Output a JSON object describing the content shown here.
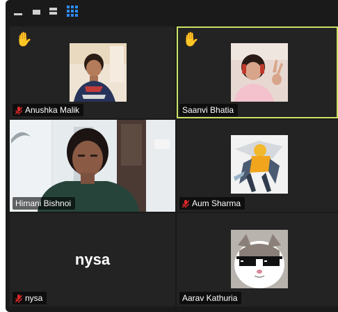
{
  "toolbar": {
    "minimize_icon": "minimize-icon",
    "stop_video_icon": "stop-video-icon",
    "speaker_view_icon": "speaker-view-icon",
    "gallery_view_icon": "gallery-view-icon"
  },
  "colors": {
    "background": "#1a1a1a",
    "tile": "#232323",
    "active_border": "#c9e265",
    "hand": "#f7b928",
    "mute": "#e02828",
    "gallery_icon": "#2d8cff"
  },
  "participants": [
    {
      "name": "Anushka Malik",
      "muted": true,
      "hand_raised": true,
      "video": "thumbnail"
    },
    {
      "name": "Saanvi Bhatia",
      "muted": false,
      "hand_raised": true,
      "video": "thumbnail",
      "active_speaker": true
    },
    {
      "name": "Himani Bishnoi",
      "muted": false,
      "hand_raised": false,
      "video": "camera"
    },
    {
      "name": "Aum Sharma",
      "muted": true,
      "hand_raised": false,
      "video": "thumbnail"
    },
    {
      "name": "nysa",
      "muted": true,
      "hand_raised": false,
      "video": "off",
      "display_text": "nysa"
    },
    {
      "name": "Aarav Kathuria",
      "muted": false,
      "hand_raised": false,
      "video": "thumbnail"
    }
  ]
}
